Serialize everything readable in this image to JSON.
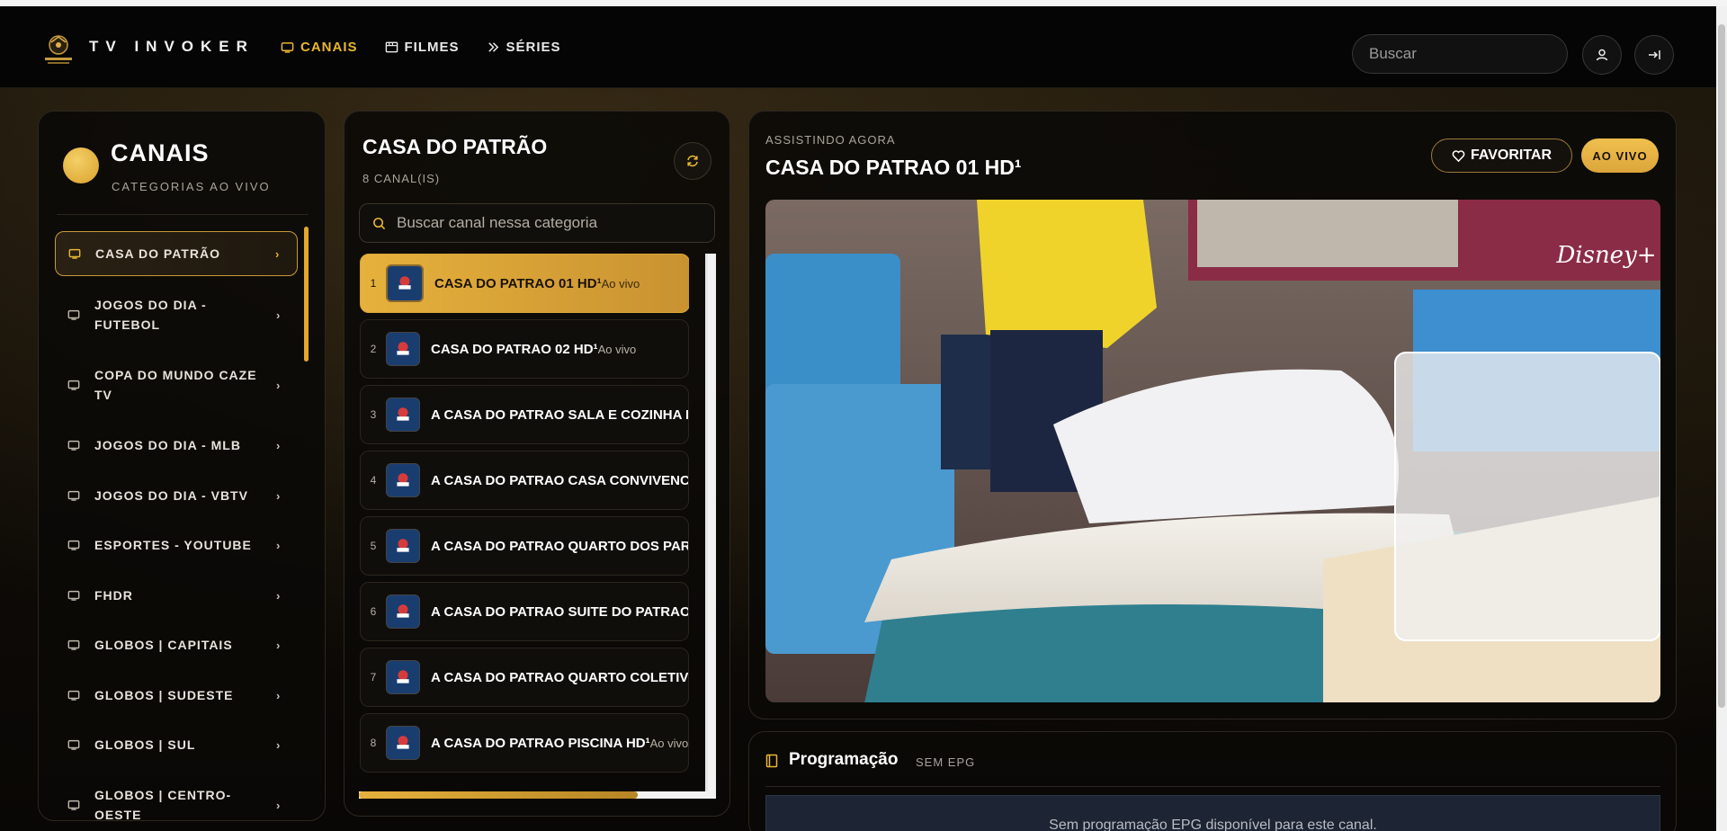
{
  "header": {
    "brand": "TV INVOKER",
    "nav": [
      {
        "label": "CANAIS",
        "active": true,
        "icon": "tv-icon"
      },
      {
        "label": "FILMES",
        "active": false,
        "icon": "film-icon"
      },
      {
        "label": "SÉRIES",
        "active": false,
        "icon": "series-icon"
      }
    ],
    "search_placeholder": "Buscar",
    "profile_icon": "user-icon",
    "logout_icon": "logout-icon"
  },
  "categories": {
    "title": "CANAIS",
    "subtitle": "CATEGORIAS AO VIVO",
    "items": [
      {
        "label": "CASA DO PATRÃO",
        "active": true
      },
      {
        "label": "JOGOS DO DIA - FUTEBOL"
      },
      {
        "label": "COPA DO MUNDO CAZE TV"
      },
      {
        "label": "JOGOS DO DIA - MLB"
      },
      {
        "label": "JOGOS DO DIA - VBTV"
      },
      {
        "label": "ESPORTES - YOUTUBE"
      },
      {
        "label": "FHDR"
      },
      {
        "label": "GLOBOS | CAPITAIS"
      },
      {
        "label": "GLOBOS | SUDESTE"
      },
      {
        "label": "GLOBOS | SUL"
      },
      {
        "label": "GLOBOS | CENTRO-OESTE"
      }
    ]
  },
  "channels": {
    "title": "CASA DO PATRÃO",
    "count": "8 CANAL(IS)",
    "search_placeholder": "Buscar canal nessa categoria",
    "items": [
      {
        "num": "1",
        "name": "CASA DO PATRAO 01 HD¹",
        "live": "Ao vivo",
        "active": true
      },
      {
        "num": "2",
        "name": "CASA DO PATRAO 02 HD¹",
        "live": "Ao vivo"
      },
      {
        "num": "3",
        "name": "A CASA DO PATRAO SALA E COZINHA HD",
        "live": ""
      },
      {
        "num": "4",
        "name": "A CASA DO PATRAO CASA CONVIVENCIA",
        "live": ""
      },
      {
        "num": "5",
        "name": "A CASA DO PATRAO QUARTO DOS PARÇA",
        "live": ""
      },
      {
        "num": "6",
        "name": "A CASA DO PATRAO SUITE DO PATRAO H",
        "live": ""
      },
      {
        "num": "7",
        "name": "A CASA DO PATRAO QUARTO COLETIVO",
        "live": ""
      },
      {
        "num": "8",
        "name": "A CASA DO PATRAO PISCINA HD¹",
        "live": "Ao vivo"
      }
    ]
  },
  "player": {
    "eyebrow": "ASSISTINDO AGORA",
    "title": "CASA DO PATRAO 01 HD¹",
    "favorite_label": "FAVORITAR",
    "live_label": "AO VIVO",
    "watermark": "Disney+"
  },
  "epg": {
    "title": "Programação",
    "subtitle": "SEM EPG",
    "empty_message": "Sem programação EPG disponível para este canal."
  },
  "colors": {
    "accent": "#e8b634",
    "background": "#0b0906"
  }
}
